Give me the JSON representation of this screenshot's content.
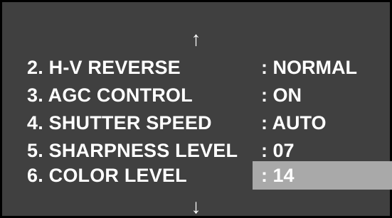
{
  "scroll": {
    "up_arrow": "↑",
    "down_arrow": "↓"
  },
  "menu": {
    "items": [
      {
        "label": "2. H-V REVERSE",
        "value": ": NORMAL"
      },
      {
        "label": "3. AGC CONTROL",
        "value": ": ON"
      },
      {
        "label": "4. SHUTTER SPEED",
        "value": ": AUTO"
      },
      {
        "label": "5. SHARPNESS LEVEL",
        "value": ": 07"
      },
      {
        "label": "6. COLOR LEVEL",
        "value": ": 14",
        "selected": true
      }
    ]
  },
  "colors": {
    "background": "#404040",
    "text": "#ffffff",
    "highlight": "#a9a9a9",
    "border": "#000000"
  }
}
